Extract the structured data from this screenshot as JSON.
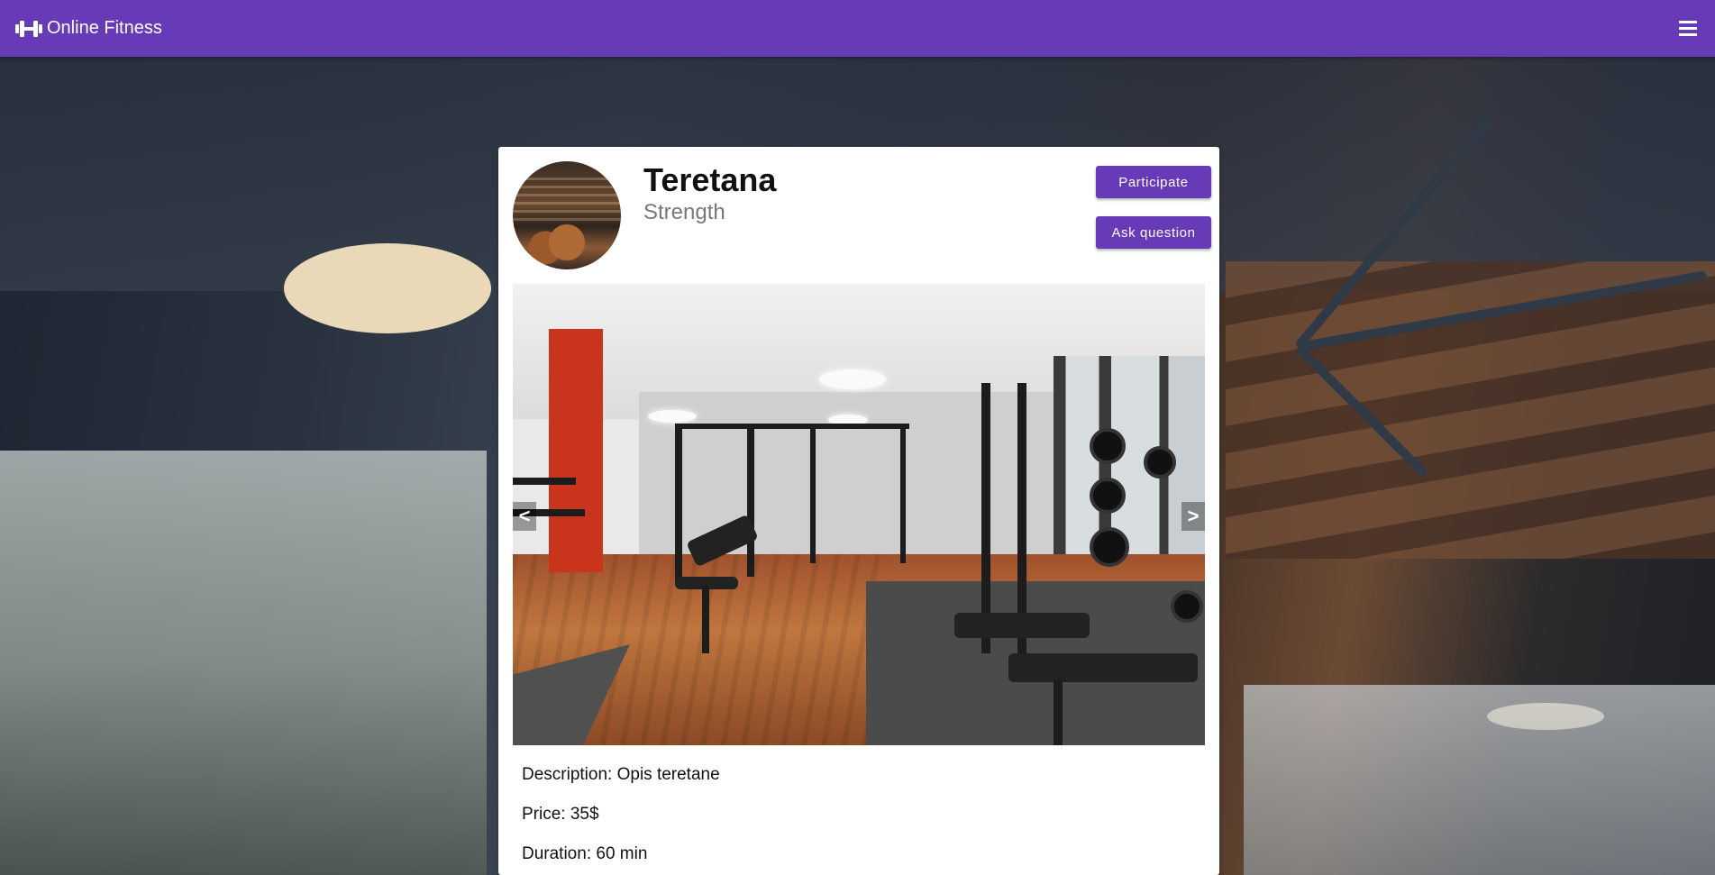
{
  "app": {
    "title": "Online Fitness",
    "logo_icon": "dumbbell-icon",
    "menu_icon": "hamburger-menu-icon",
    "brand_color": "#673ab7"
  },
  "class": {
    "name": "Teretana",
    "category": "Strength",
    "avatar_alt": "gym avatar"
  },
  "actions": {
    "participate_label": "Participate",
    "ask_label": "Ask question"
  },
  "carousel": {
    "prev_label": "<",
    "next_label": ">"
  },
  "details": {
    "description": "Description: Opis teretane",
    "price": "Price: 35$",
    "duration": "Duration: 60 min"
  }
}
